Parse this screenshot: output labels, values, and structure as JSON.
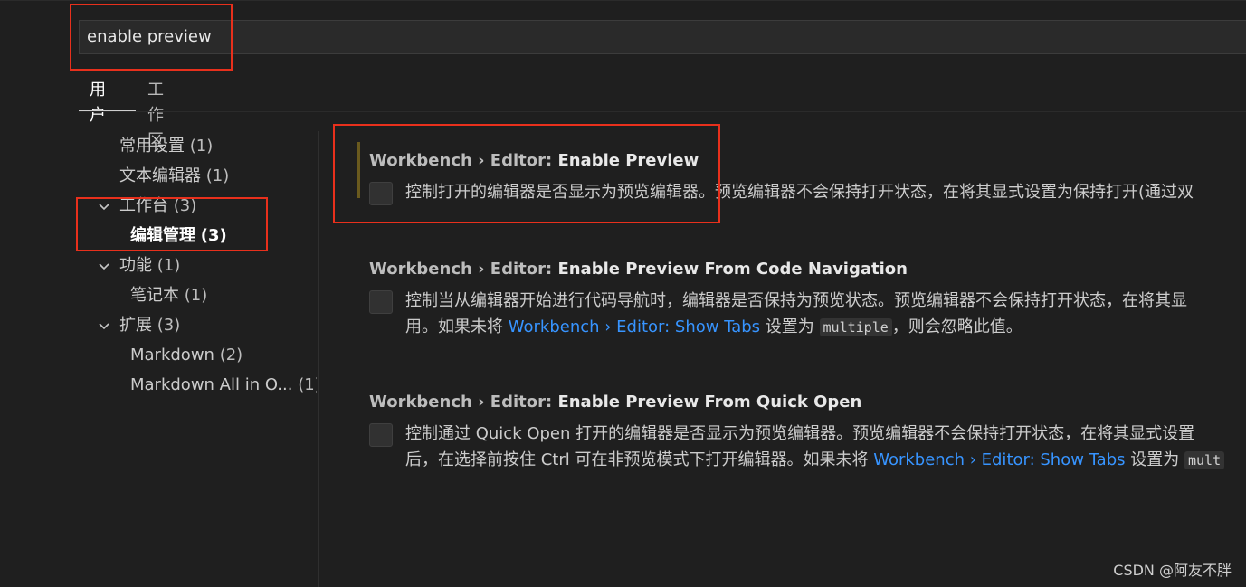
{
  "search": {
    "value": "enable preview"
  },
  "tabs": [
    {
      "label": "用户",
      "active": true
    },
    {
      "label": "工作区",
      "active": false
    }
  ],
  "tree": {
    "items": [
      {
        "label": "常用设置",
        "count": "(1)"
      },
      {
        "label": "文本编辑器",
        "count": "(1)"
      },
      {
        "label": "工作台",
        "count": "(3)",
        "expanded": true
      },
      {
        "label": "编辑管理",
        "count": "(3)",
        "selected": true
      },
      {
        "label": "功能",
        "count": "(1)",
        "expanded": true
      },
      {
        "label": "笔记本",
        "count": "(1)"
      },
      {
        "label": "扩展",
        "count": "(3)",
        "expanded": true
      },
      {
        "label": "Markdown",
        "count": "(2)"
      },
      {
        "label": "Markdown All in O...",
        "count": "(1)"
      }
    ]
  },
  "settings": [
    {
      "category": "Workbench › Editor: ",
      "name": "Enable Preview",
      "modified": true,
      "checked": false,
      "desc_line1": "控制打开的编辑器是否显示为预览编辑器。预览编辑器不会保持打开状态，在将其显式设置为保持打开(通过双"
    },
    {
      "category": "Workbench › Editor: ",
      "name": "Enable Preview From Code Navigation",
      "modified": false,
      "checked": false,
      "desc_line1": "控制当从编辑器开始进行代码导航时，编辑器是否保持为预览状态。预览编辑器不会保持打开状态，在将其显",
      "desc_line2_pre": "用。如果未将 ",
      "desc_line2_link": "Workbench › Editor: Show Tabs",
      "desc_line2_mid": " 设置为 ",
      "desc_line2_code": "multiple",
      "desc_line2_post": "，则会忽略此值。"
    },
    {
      "category": "Workbench › Editor: ",
      "name": "Enable Preview From Quick Open",
      "modified": false,
      "checked": false,
      "desc_line1": "控制通过 Quick Open 打开的编辑器是否显示为预览编辑器。预览编辑器不会保持打开状态，在将其显式设置",
      "desc_line2_pre": "后，在选择前按住 Ctrl 可在非预览模式下打开编辑器。如果未将 ",
      "desc_line2_link": "Workbench › Editor: Show Tabs",
      "desc_line2_mid": " 设置为 ",
      "desc_line2_code": "mult"
    }
  ],
  "watermark": "CSDN @阿友不胖",
  "colors": {
    "background": "#1f1f1f",
    "link": "#3794ff",
    "highlight": "#e8301c",
    "modified": "#6a5a1e"
  }
}
